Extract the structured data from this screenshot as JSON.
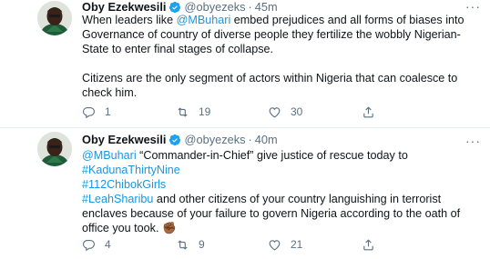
{
  "tweets": [
    {
      "author": {
        "name": "Oby Ezekwesili",
        "handle": "@obyezeks",
        "verified": true,
        "avatar": "avatar-photo"
      },
      "time": "45m",
      "body": {
        "p1_a": "When leaders like ",
        "p1_mention": "@MBuhari",
        "p1_b": "  embed prejudices and all forms of biases into Governance of country of diverse people they fertilize the wobbly Nigerian-State to enter final stages of collapse.",
        "p2": "Citizens are the only segment of actors within Nigeria that can coalesce to check him."
      },
      "actions": {
        "replies": "1",
        "retweets": "19",
        "likes": "30"
      }
    },
    {
      "author": {
        "name": "Oby Ezekwesili",
        "handle": "@obyezeks",
        "verified": true,
        "avatar": "avatar-photo"
      },
      "time": "40m",
      "body": {
        "mention": "@MBuhari",
        "line1_rest": " “Commander-in-Chief” give justice of rescue today to",
        "hashtag1": "#KadunaThirtyNine",
        "hashtag2": "#112ChibokGirls",
        "hashtag3": "#LeahSharibu",
        "rest": " and other citizens of your country languishing in terrorist enclaves because of your failure to govern Nigeria according to the oath of office you took. ",
        "emoji": "✊🏾"
      },
      "actions": {
        "replies": "4",
        "retweets": "9",
        "likes": "21"
      }
    }
  ],
  "ui": {
    "separator": "·",
    "more_icon": "more-dots-icon",
    "more_glyph": "···",
    "icons": [
      "reply-icon",
      "retweet-icon",
      "like-icon",
      "share-icon",
      "verified-badge-icon"
    ]
  },
  "colors": {
    "link": "#1b95e0",
    "secondary_text": "#5b7083",
    "verified": "#1da1f2",
    "divider": "#e6ecf0"
  }
}
